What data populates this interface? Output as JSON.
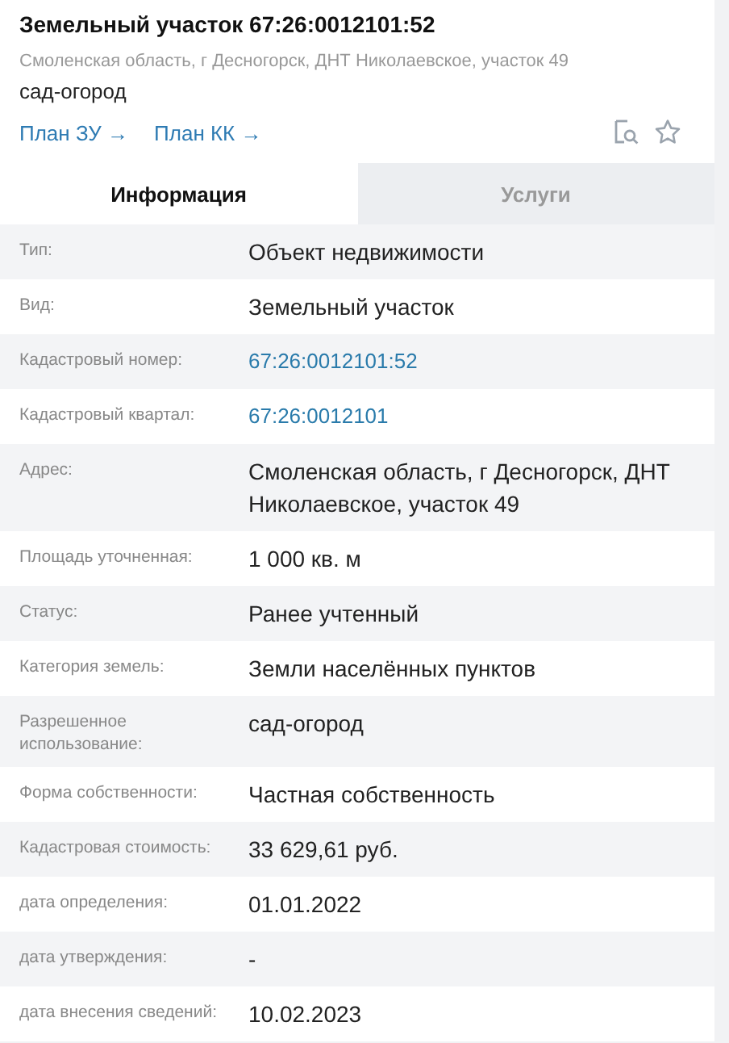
{
  "header": {
    "title": "Земельный участок 67:26:0012101:52",
    "address": "Смоленская область, г Десногорск, ДНТ Николаевское, участок 49",
    "usage": "сад-огород",
    "links": [
      {
        "label": "План ЗУ →"
      },
      {
        "label": "План КК →"
      }
    ]
  },
  "tabs": [
    {
      "label": "Информация",
      "selected": true
    },
    {
      "label": "Услуги",
      "selected": false
    }
  ],
  "rows": [
    {
      "label": "Тип:",
      "value": "Объект недвижимости",
      "kind": "text"
    },
    {
      "label": "Вид:",
      "value": "Земельный участок",
      "kind": "text"
    },
    {
      "label": "Кадастровый номер:",
      "value": "67:26:0012101:52",
      "kind": "link"
    },
    {
      "label": "Кадастровый квартал:",
      "value": "67:26:0012101",
      "kind": "link"
    },
    {
      "label": "Адрес:",
      "value": "Смоленская область, г Десногорск, ДНТ Николаевское, участок 49",
      "kind": "text"
    },
    {
      "label": "Площадь уточненная:",
      "value": "1 000 кв. м",
      "kind": "text"
    },
    {
      "label": "Статус:",
      "value": "Ранее учтенный",
      "kind": "text"
    },
    {
      "label": "Категория земель:",
      "value": "Земли населённых пунктов",
      "kind": "text"
    },
    {
      "label": "Разрешенное использование:",
      "value": "сад-огород",
      "kind": "text"
    },
    {
      "label": "Форма собственности:",
      "value": "Частная собственность",
      "kind": "text"
    },
    {
      "label": "Кадастровая стоимость:",
      "value": "33 629,61 руб.",
      "kind": "text"
    },
    {
      "label": "дата определения:",
      "value": "01.01.2022",
      "kind": "text"
    },
    {
      "label": "дата утверждения:",
      "value": "-",
      "kind": "text"
    },
    {
      "label": "дата внесения сведений:",
      "value": "10.02.2023",
      "kind": "text"
    }
  ]
}
